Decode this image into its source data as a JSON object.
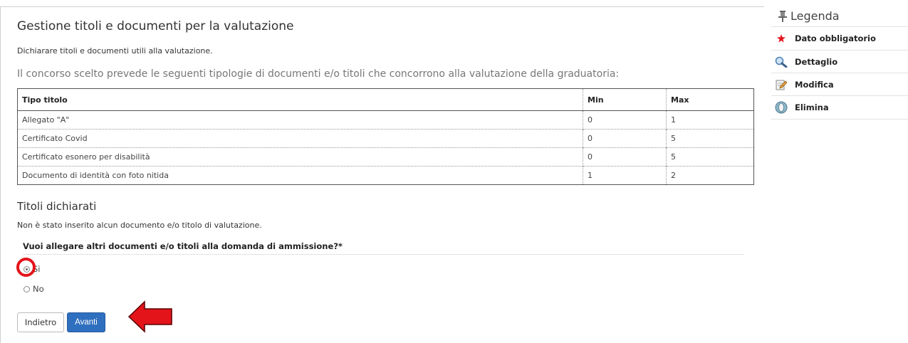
{
  "main": {
    "title": "Gestione titoli e documenti per la valutazione",
    "intro": "Dichiarare titoli e documenti utili alla valutazione.",
    "concorso_text": "Il concorso scelto prevede le seguenti tipologie di documenti e/o titoli che concorrono alla valutazione della graduatoria:",
    "table": {
      "headers": [
        "Tipo titolo",
        "Min",
        "Max"
      ],
      "rows": [
        [
          "Allegato \"A\"",
          "0",
          "1"
        ],
        [
          "Certificato Covid",
          "0",
          "5"
        ],
        [
          "Certificato esonero per disabilità",
          "0",
          "5"
        ],
        [
          "Documento di identità con foto nitida",
          "1",
          "2"
        ]
      ]
    },
    "titoli_heading": "Titoli dichiarati",
    "no_docs_text": "Non è stato inserito alcun documento e/o titolo di valutazione.",
    "question": "Vuoi allegare altri documenti e/o titoli alla domanda di ammissione?*",
    "options": {
      "si": "Si",
      "no": "No",
      "selected": "Si"
    },
    "buttons": {
      "back": "Indietro",
      "next": "Avanti"
    }
  },
  "legend": {
    "title": "Legenda",
    "items": [
      {
        "label": "Dato obbligatorio",
        "icon": "required-star-icon"
      },
      {
        "label": "Dettaglio",
        "icon": "magnifier-icon"
      },
      {
        "label": "Modifica",
        "icon": "edit-icon"
      },
      {
        "label": "Elimina",
        "icon": "delete-icon"
      }
    ]
  },
  "colors": {
    "highlight": "#e4141b",
    "primary_button": "#2f6fbf"
  }
}
